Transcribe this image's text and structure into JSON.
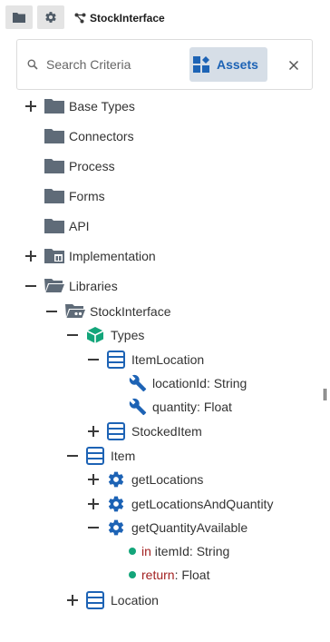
{
  "toolbar": {
    "files_icon": "folder-icon",
    "settings_icon": "gear-icon"
  },
  "tab": {
    "title": "StockInterface",
    "icon": "interface-icon"
  },
  "search": {
    "placeholder": "Search Criteria",
    "value": ""
  },
  "assets_button": {
    "label": "Assets"
  },
  "colors": {
    "folder": "#5f6b78",
    "accent_blue": "#1d63b5",
    "teal": "#13a57a",
    "keyword": "#a32222",
    "assets_bg": "#d6dee7"
  },
  "tree": {
    "base_types": "Base Types",
    "connectors": "Connectors",
    "process": "Process",
    "forms": "Forms",
    "api": "API",
    "implementation": "Implementation",
    "libraries": "Libraries",
    "stockinterface": "StockInterface",
    "types": "Types",
    "itemlocation": "ItemLocation",
    "locationid": {
      "name": "locationId",
      "type": ": String"
    },
    "quantity": {
      "name": "quantity",
      "type": ": Float"
    },
    "stockeditem": "StockedItem",
    "item": "Item",
    "getlocations": "getLocations",
    "getlocationsandquantity": "getLocationsAndQuantity",
    "getquantityavailable": "getQuantityAvailable",
    "param_in": {
      "keyword": "in",
      "name": " itemId",
      "type": ": String"
    },
    "param_return": {
      "keyword": "return",
      "type": ": Float"
    },
    "location": "Location"
  }
}
